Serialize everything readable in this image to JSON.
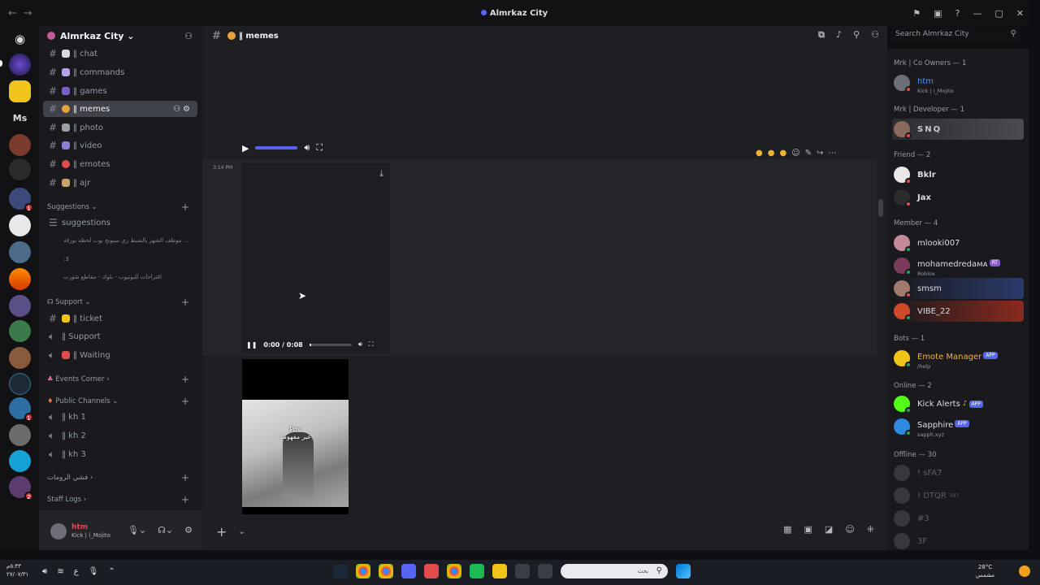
{
  "window": {
    "title": "Almrkaz City",
    "nav_back": "←",
    "nav_forward": "→",
    "controls": [
      "⚑",
      "▣",
      "?",
      "—",
      "▢",
      "✕"
    ]
  },
  "server": {
    "name": "Almrkaz City",
    "chevron": "⌄"
  },
  "channels": [
    {
      "label": "‖ chat",
      "icon": "speech-bubble-icon",
      "color": "#d9d9d9"
    },
    {
      "label": "‖ commands",
      "icon": "robot-icon",
      "color": "#b8a2e8"
    },
    {
      "label": "‖ games",
      "icon": "gamepad-icon",
      "color": "#7b61c4"
    },
    {
      "label": "‖ memes",
      "icon": "emoji-icon",
      "color": "#e6a23c",
      "active": true
    },
    {
      "label": "‖ photo",
      "icon": "camera-icon",
      "color": "#9aa0a6"
    },
    {
      "label": "‖ video",
      "icon": "film-icon",
      "color": "#8a7fd1"
    },
    {
      "label": "‖ emotes",
      "icon": "smile-icon",
      "color": "#e24b4b"
    },
    {
      "label": "‖ ajr",
      "icon": "book-icon",
      "color": "#c9a46a"
    }
  ],
  "suggestions_category": "Suggestions",
  "suggestions_channel": "suggestions",
  "threads": [
    "موظف الشهر بالضبط زي سبونج بوب لحظه بورقة ...",
    ":3",
    "اقتراحات لليوتيوب - بلوك - مقاطع شورت"
  ],
  "support_category": "Support",
  "support_channels": [
    {
      "label": "‖ ticket",
      "type": "text"
    },
    {
      "label": "‖ Support",
      "type": "voice"
    },
    {
      "label": "‖ Waiting",
      "type": "voice"
    }
  ],
  "events_category": "Events Corner",
  "public_category": "Public Channels",
  "public_channels": [
    "‖ kh 1",
    "‖ kh 2",
    "‖ kh 3"
  ],
  "rooms_category": "فشي الرومات",
  "staff_category": "Staff Logs",
  "user": {
    "name": "htm",
    "status": "Kick | i_Mojito"
  },
  "current_channel": {
    "name": "‖ memes"
  },
  "search": {
    "placeholder": "Search Almrkaz City"
  },
  "message": {
    "time": "3:14 PM",
    "video_time": "0:00 / 0:08",
    "video_progress": 0.05,
    "caption_line1": "Pov",
    "caption_line2": "غير مفهومة"
  },
  "member_groups": [
    {
      "title": "Mrk | Co Owners — 1",
      "members": [
        {
          "name": "htm",
          "sub": "Kick | i_Mojito",
          "color": "#4e8df0",
          "status": "#e24b4b"
        }
      ]
    },
    {
      "title": "Mrk | Developer — 1",
      "members": [
        {
          "name": "SNQ",
          "color": "#c7c7c7",
          "status": "#e24b4b"
        }
      ]
    },
    {
      "title": "Friend — 2",
      "members": [
        {
          "name": "Bklr",
          "color": "#f2f3f5",
          "status": "#e24b4b"
        },
        {
          "name": "Jax",
          "color": "#f2f3f5",
          "status": "#e24b4b"
        }
      ]
    },
    {
      "title": "Member — 4",
      "members": [
        {
          "name": "mlooki007",
          "color": "#dbdee1",
          "status": "#23a55a"
        },
        {
          "name": "mohamedredaᴍᴀ",
          "sub": "Roblox",
          "badge": "RT",
          "color": "#dbdee1",
          "status": "#23a55a"
        },
        {
          "name": "smsm",
          "color": "#dbdee1",
          "status": "#e24b4b"
        },
        {
          "name": "VIBE_22",
          "color": "#dbdee1",
          "status": "#23a55a"
        }
      ]
    },
    {
      "title": "Bots — 1",
      "members": [
        {
          "name": "Emote Manager",
          "sub": "/help",
          "badge": "APP",
          "color": "#f0b232",
          "status": "#23a55a"
        }
      ]
    },
    {
      "title": "Online — 2",
      "members": [
        {
          "name": "Kick Alerts",
          "badge": "APP",
          "color": "#dbdee1",
          "status": "#23a55a"
        },
        {
          "name": "Sapphire",
          "sub": "sapph.xyz",
          "badge": "APP",
          "color": "#dbdee1",
          "status": "#23a55a"
        }
      ]
    },
    {
      "title": "Offline — 30",
      "members": [
        {
          "name": "! sFA7",
          "color": "#949ba4",
          "offline": true
        },
        {
          "name": "! DTQR",
          "badge": "507",
          "color": "#949ba4",
          "offline": true
        },
        {
          "name": "#3",
          "color": "#949ba4",
          "offline": true
        },
        {
          "name": "3F",
          "color": "#949ba4",
          "offline": true
        }
      ]
    }
  ],
  "taskbar": {
    "clock_time": "٥:٣٣م",
    "clock_date": "٢٧/٠٧/٣١",
    "lang": "ع",
    "search_placeholder": "بحث",
    "temp": "28°C",
    "weather": "مشمس"
  }
}
